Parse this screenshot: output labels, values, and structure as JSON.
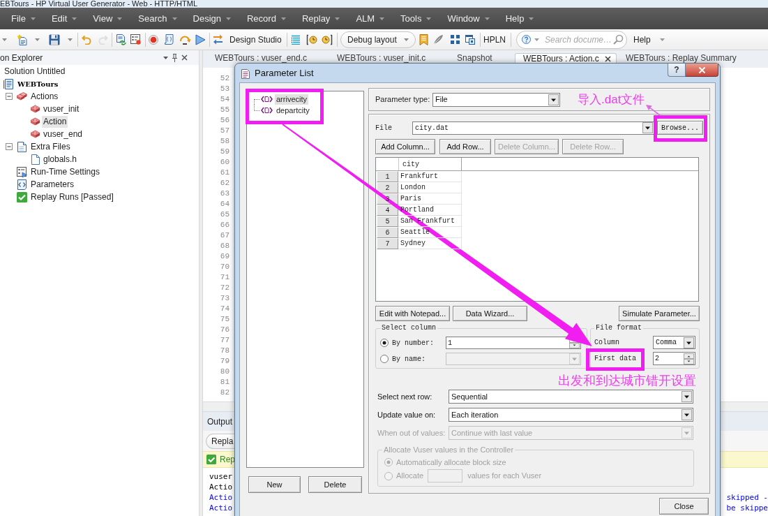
{
  "window": {
    "title": "EBTours - HP Virtual User Generator - Web - HTTP/HTML"
  },
  "menu": [
    "File",
    "Edit",
    "View",
    "Search",
    "Design",
    "Record",
    "Replay",
    "ALM",
    "Tools",
    "Window",
    "Help"
  ],
  "toolbar": {
    "design_studio": "Design Studio",
    "layout": "Debug layout",
    "hpln": "HPLN",
    "search": {
      "placeholder": "Search docume…"
    },
    "help": "Help"
  },
  "solution_explorer": {
    "title": "on Explorer",
    "tree": [
      {
        "label": "Solution Untitled",
        "kind": "solution",
        "selected": false
      },
      {
        "label": "WEBTours",
        "kind": "script",
        "selected": false
      },
      {
        "label": "Actions",
        "kind": "actions",
        "expanded": true,
        "selected": false,
        "children": [
          {
            "label": "vuser_init",
            "kind": "action",
            "selected": false
          },
          {
            "label": "Action",
            "kind": "action",
            "selected": true
          },
          {
            "label": "vuser_end",
            "kind": "action",
            "selected": false
          }
        ]
      },
      {
        "label": "Extra Files",
        "kind": "files",
        "expanded": true,
        "selected": false,
        "children": [
          {
            "label": "globals.h",
            "kind": "file",
            "selected": false
          }
        ]
      },
      {
        "label": "Run-Time Settings",
        "kind": "settings",
        "selected": false
      },
      {
        "label": "Parameters",
        "kind": "parameters",
        "selected": false
      },
      {
        "label": "Replay Runs [Passed]",
        "kind": "replay",
        "selected": false
      }
    ]
  },
  "editor": {
    "tabs": [
      {
        "label": "WEBTours : vuser_end.c",
        "selected": false
      },
      {
        "label": "WEBTours : vuser_init.c",
        "selected": false
      },
      {
        "label": "Snapshot",
        "selected": false
      },
      {
        "label": "WEBTours : Action.c",
        "selected": true
      },
      {
        "label": "WEBTours : Replay Summary",
        "selected": false
      }
    ],
    "line_numbers": [
      "52",
      "53",
      "54",
      "55",
      "56",
      "57",
      "58",
      "59",
      "60",
      "61",
      "62",
      "63",
      "64",
      "65",
      "66",
      "67",
      "68",
      "69",
      "70",
      "71",
      "72",
      "73",
      "74",
      "75",
      "76",
      "77",
      "78",
      "79",
      "80",
      "81",
      "82"
    ]
  },
  "output": {
    "title": "Output",
    "button": "Repla",
    "status": "Rep",
    "lines": [
      {
        "text": "vuser",
        "color": "#000000"
      },
      {
        "text": "Actio",
        "color": "#000000"
      },
      {
        "text": "Actio",
        "tail": "skipped -",
        "color": "#0000ff"
      },
      {
        "text": "Actio",
        "tail": "be skippe",
        "color": "#0000ff"
      }
    ]
  },
  "dialog": {
    "title": "Parameter List",
    "help": "?",
    "parameters": [
      {
        "label": "arrivecity",
        "selected": true
      },
      {
        "label": "departcity",
        "selected": false
      }
    ],
    "list_buttons": [
      "New",
      "Delete"
    ],
    "parameter_type": {
      "label": "Parameter type:",
      "value": "File"
    },
    "file": {
      "label": "File",
      "value": "city.dat",
      "button": "Browse..."
    },
    "table_buttons": [
      {
        "label": "Add Column...",
        "disabled": false
      },
      {
        "label": "Add Row...",
        "disabled": false
      },
      {
        "label": "Delete Column...",
        "disabled": true
      },
      {
        "label": "Delete Row...",
        "disabled": true
      }
    ],
    "table": {
      "columns": [
        "city"
      ],
      "rows": [
        {
          "number": "1",
          "cells": [
            "Frankfurt"
          ]
        },
        {
          "number": "2",
          "cells": [
            "London"
          ]
        },
        {
          "number": "3",
          "cells": [
            "Paris"
          ]
        },
        {
          "number": "4",
          "cells": [
            "Portland"
          ]
        },
        {
          "number": "5",
          "cells": [
            "San Frankfurt"
          ]
        },
        {
          "number": "6",
          "cells": [
            "Seattle"
          ]
        },
        {
          "number": "7",
          "cells": [
            "Sydney"
          ]
        }
      ]
    },
    "data_buttons": [
      "Edit with Notepad...",
      "Data Wizard...",
      "Simulate Parameter..."
    ],
    "select_column": {
      "title": "Select column",
      "options": [
        {
          "label": "By number:",
          "kind": "spinner",
          "value": "1",
          "selected": true,
          "disabled": false
        },
        {
          "label": "By name:",
          "kind": "dropdown",
          "selected": false,
          "disabled": true
        }
      ]
    },
    "file_format": {
      "title": "File format",
      "column": {
        "label": "Column",
        "value": "Comma"
      },
      "first_data": {
        "label": "First data",
        "value": "2"
      }
    },
    "settings": [
      {
        "label": "Select next row:",
        "value": "Sequential",
        "disabled": false
      },
      {
        "label": "Update value on:",
        "value": "Each iteration",
        "disabled": false
      },
      {
        "label": "When out of values:",
        "value": "Continue with last value",
        "disabled": true
      }
    ],
    "allocate": {
      "title": "Allocate Vuser values in the Controller",
      "disabled": true,
      "options": [
        {
          "label": "Automatically allocate block size",
          "kind": "plain",
          "selected": true
        },
        {
          "label": "Allocate",
          "kind": "field",
          "after": "values for each Vuser",
          "selected": false
        }
      ]
    },
    "close": "Close"
  },
  "annotations": [
    {
      "text": "导入.dat文件"
    },
    {
      "text": "出发和到达城市错开设置"
    }
  ]
}
